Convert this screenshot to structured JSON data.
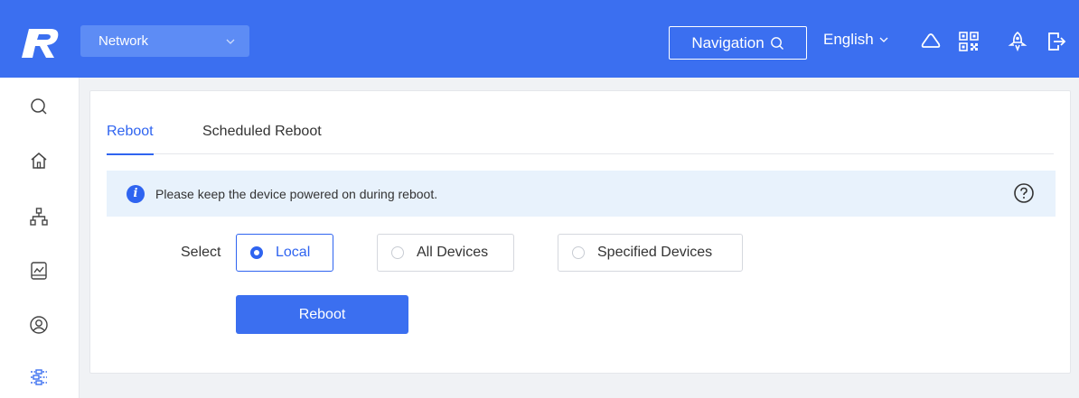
{
  "header": {
    "network_select": "Network",
    "navigation_label": "Navigation",
    "language": "English"
  },
  "tabs": [
    {
      "label": "Reboot",
      "active": true
    },
    {
      "label": "Scheduled Reboot",
      "active": false
    }
  ],
  "alert": {
    "message": "Please keep the device powered on during reboot."
  },
  "reboot_form": {
    "select_label": "Select",
    "options": [
      {
        "label": "Local",
        "selected": true
      },
      {
        "label": "All Devices",
        "selected": false
      },
      {
        "label": "Specified Devices",
        "selected": false
      }
    ],
    "reboot_button": "Reboot"
  },
  "icons": {
    "sidebar": [
      "search-icon",
      "home-icon",
      "topology-icon",
      "monitor-icon",
      "user-icon",
      "settings-icon"
    ],
    "header": [
      "cloud-icon",
      "qr-code-icon",
      "rocket-icon",
      "logout-icon"
    ]
  },
  "colors": {
    "brand_blue": "#3b6ff0",
    "select_bg": "#5d8cf5",
    "alert_bg": "#e8f2fc",
    "active_tab": "#2f64f0"
  }
}
